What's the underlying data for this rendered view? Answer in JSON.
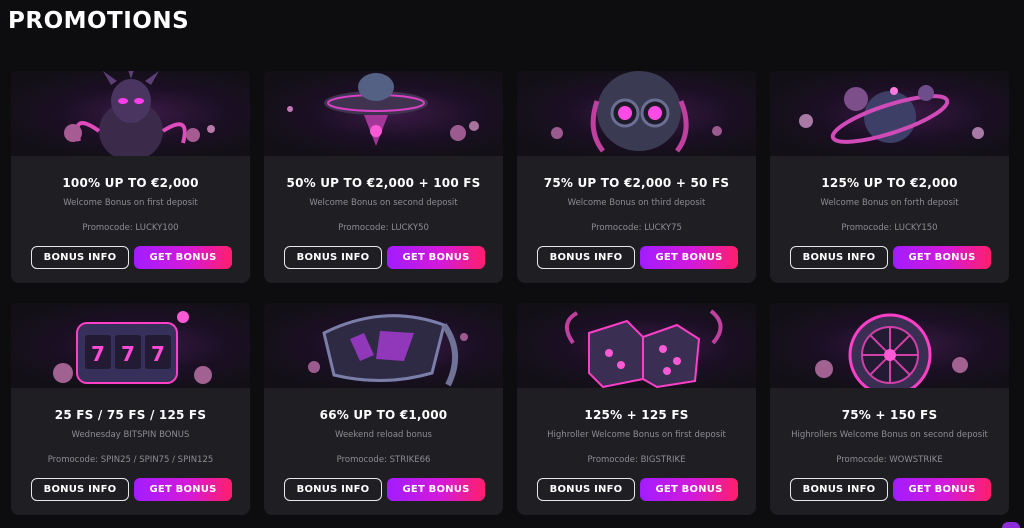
{
  "page": {
    "title": "PROMOTIONS"
  },
  "colors": {
    "background": "#0d0d10",
    "card": "#1e1e23",
    "accent_start": "#a21cff",
    "accent_end": "#ff1f6b"
  },
  "promotions": [
    {
      "art": "alien-creature-icon",
      "headline": "100% UP TO €2,000",
      "subtitle": "Welcome Bonus on first deposit",
      "promocode": "Promocode: LUCKY100",
      "info_label": "BONUS INFO",
      "get_label": "GET BONUS"
    },
    {
      "art": "ufo-icon",
      "headline": "50% UP TO €2,000 + 100 FS",
      "subtitle": "Welcome Bonus on second deposit",
      "promocode": "Promocode: LUCKY50",
      "info_label": "BONUS INFO",
      "get_label": "GET BONUS"
    },
    {
      "art": "robot-head-icon",
      "headline": "75% UP TO €2,000 + 50 FS",
      "subtitle": "Welcome Bonus on third deposit",
      "promocode": "Promocode: LUCKY75",
      "info_label": "BONUS INFO",
      "get_label": "GET BONUS"
    },
    {
      "art": "planet-icon",
      "headline": "125% UP TO €2,000",
      "subtitle": "Welcome Bonus on forth deposit",
      "promocode": "Promocode: LUCKY150",
      "info_label": "BONUS INFO",
      "get_label": "GET BONUS"
    },
    {
      "art": "slot-machine-icon",
      "headline": "25 FS / 75 FS / 125 FS",
      "subtitle": "Wednesday BITSPIN BONUS",
      "promocode": "Promocode: SPIN25 / SPIN75 / SPIN125",
      "info_label": "BONUS INFO",
      "get_label": "GET BONUS"
    },
    {
      "art": "vr-headset-icon",
      "headline": "66% UP TO €1,000",
      "subtitle": "Weekend reload bonus",
      "promocode": "Promocode: STRIKE66",
      "info_label": "BONUS INFO",
      "get_label": "GET BONUS"
    },
    {
      "art": "dice-icon",
      "headline": "125% + 125 FS",
      "subtitle": "Highroller Welcome Bonus on first deposit",
      "promocode": "Promocode: BIGSTRIKE",
      "info_label": "BONUS INFO",
      "get_label": "GET BONUS"
    },
    {
      "art": "roulette-wheel-icon",
      "headline": "75% + 150 FS",
      "subtitle": "Highrollers Welcome Bonus on second deposit",
      "promocode": "Promocode: WOWSTRIKE",
      "info_label": "BONUS INFO",
      "get_label": "GET BONUS"
    }
  ]
}
